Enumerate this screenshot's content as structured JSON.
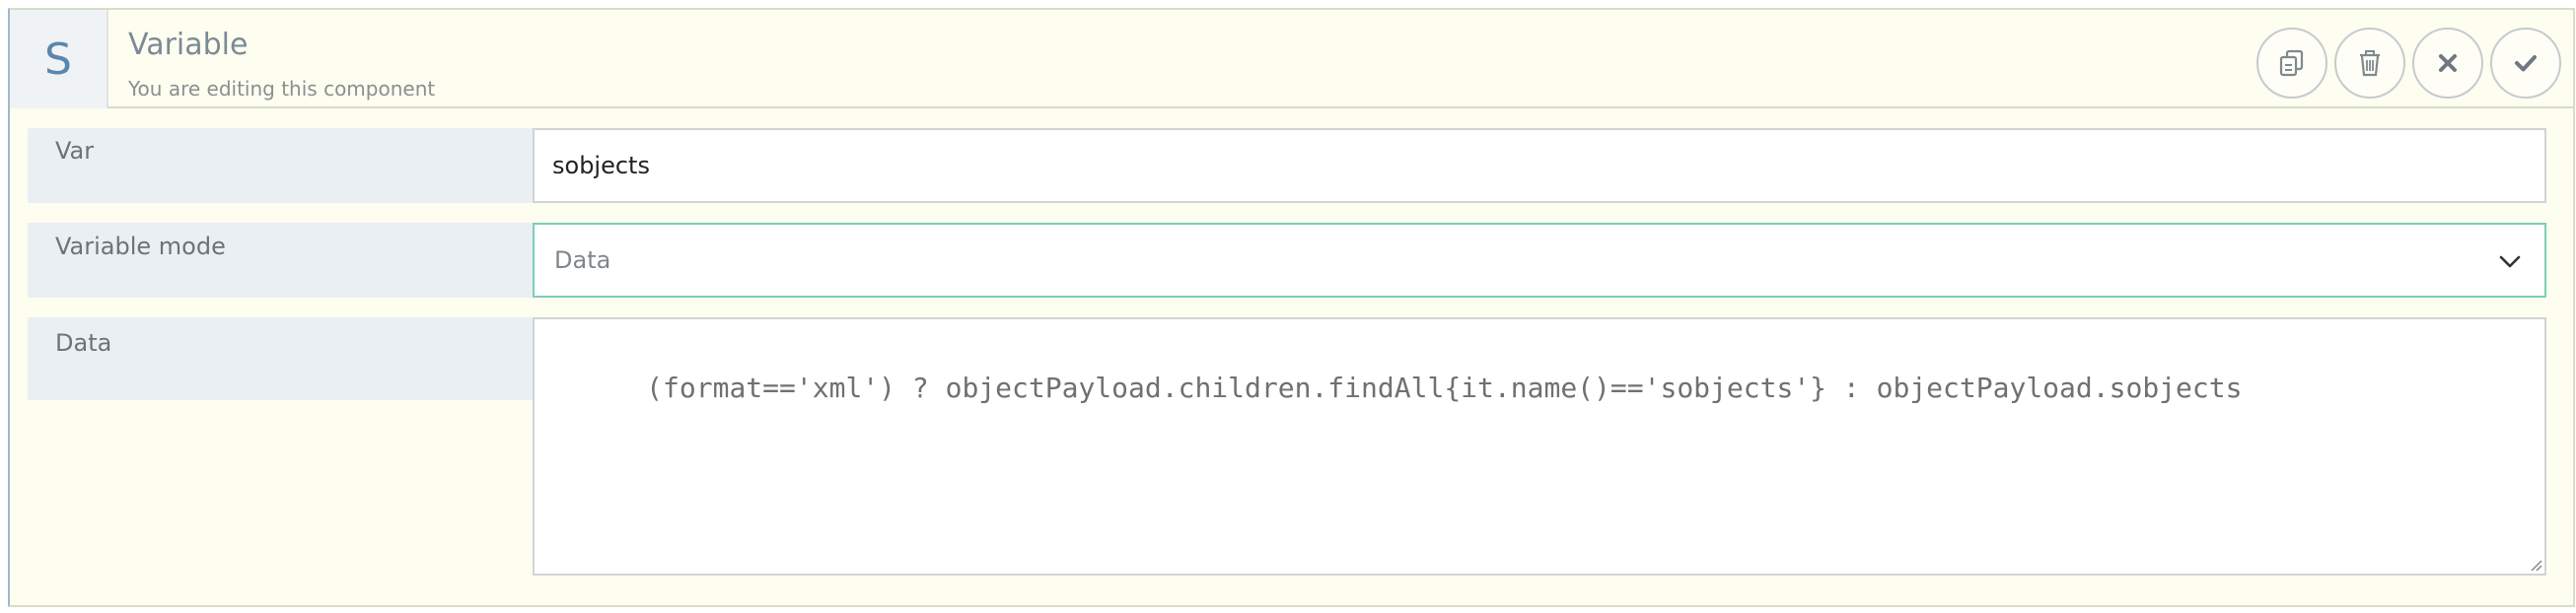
{
  "header": {
    "avatar_letter": "S",
    "title": "Variable",
    "subtitle": "You are editing this component"
  },
  "actions": {
    "copy": "copy-icon",
    "delete": "trash-icon",
    "cancel": "close-icon",
    "confirm": "check-icon"
  },
  "form": {
    "var": {
      "label": "Var",
      "value": "sobjects"
    },
    "mode": {
      "label": "Variable mode",
      "value": "Data"
    },
    "data": {
      "label": "Data",
      "value": "(format=='xml') ? objectPayload.children.findAll{it.name()=='sobjects'} : objectPayload.sobjects"
    }
  },
  "colors": {
    "panel_bg": "#fdfdf0",
    "label_bg": "#eaeff3",
    "accent_avatar": "#5b86ad",
    "focus_border": "#7ccfb3"
  }
}
